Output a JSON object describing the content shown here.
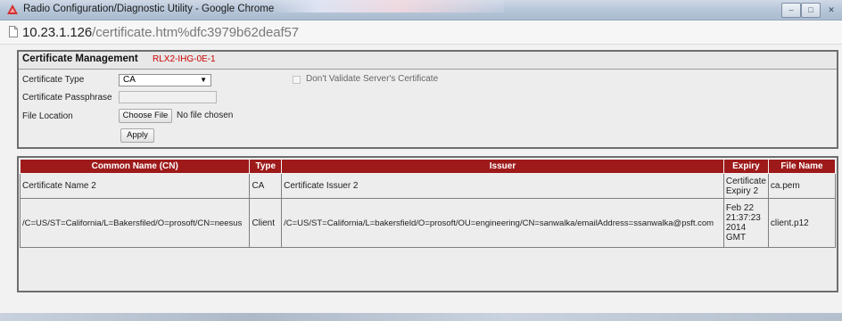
{
  "window": {
    "title": "Radio Configuration/Diagnostic Utility - Google Chrome",
    "minimize_glyph": "–",
    "maximize_glyph": "□",
    "close_glyph": "✕",
    "app_icon": "prosoft-logo-icon"
  },
  "address_bar": {
    "host": "10.23.1.126",
    "path": "/certificate.htm%dfc3979b62deaf57",
    "page_icon": "page-icon"
  },
  "panel": {
    "title": "Certificate Management",
    "device_name": "RLX2-IHG-0E-1",
    "certificate_type_label": "Certificate Type",
    "certificate_type_value": "CA",
    "passphrase_label": "Certificate Passphrase",
    "passphrase_value": "",
    "file_location_label": "File Location",
    "choose_file_label": "Choose File",
    "no_file_text": "No file chosen",
    "apply_label": "Apply",
    "dont_validate_label": "Don't Validate Server's Certificate",
    "dont_validate_checked": false
  },
  "table": {
    "headers": [
      "Common Name (CN)",
      "Type",
      "Issuer",
      "Expiry",
      "File Name"
    ],
    "rows": [
      [
        "Certificate Name 2",
        "CA",
        "Certificate Issuer 2",
        "Certificate Expiry 2",
        "ca.pem"
      ],
      [
        "/C=US/ST=California/L=Bakersfiled/O=prosoft/CN=neesus",
        "Client",
        "/C=US/ST=California/L=bakersfield/O=prosoft/OU=engineering/CN=sanwalka/emailAddress=ssanwalka@psft.com",
        "Feb 22 21:37:23 2014 GMT",
        "client.p12"
      ]
    ]
  },
  "colors": {
    "table_header": "#9e1a1a",
    "device_name": "#cc0000"
  }
}
